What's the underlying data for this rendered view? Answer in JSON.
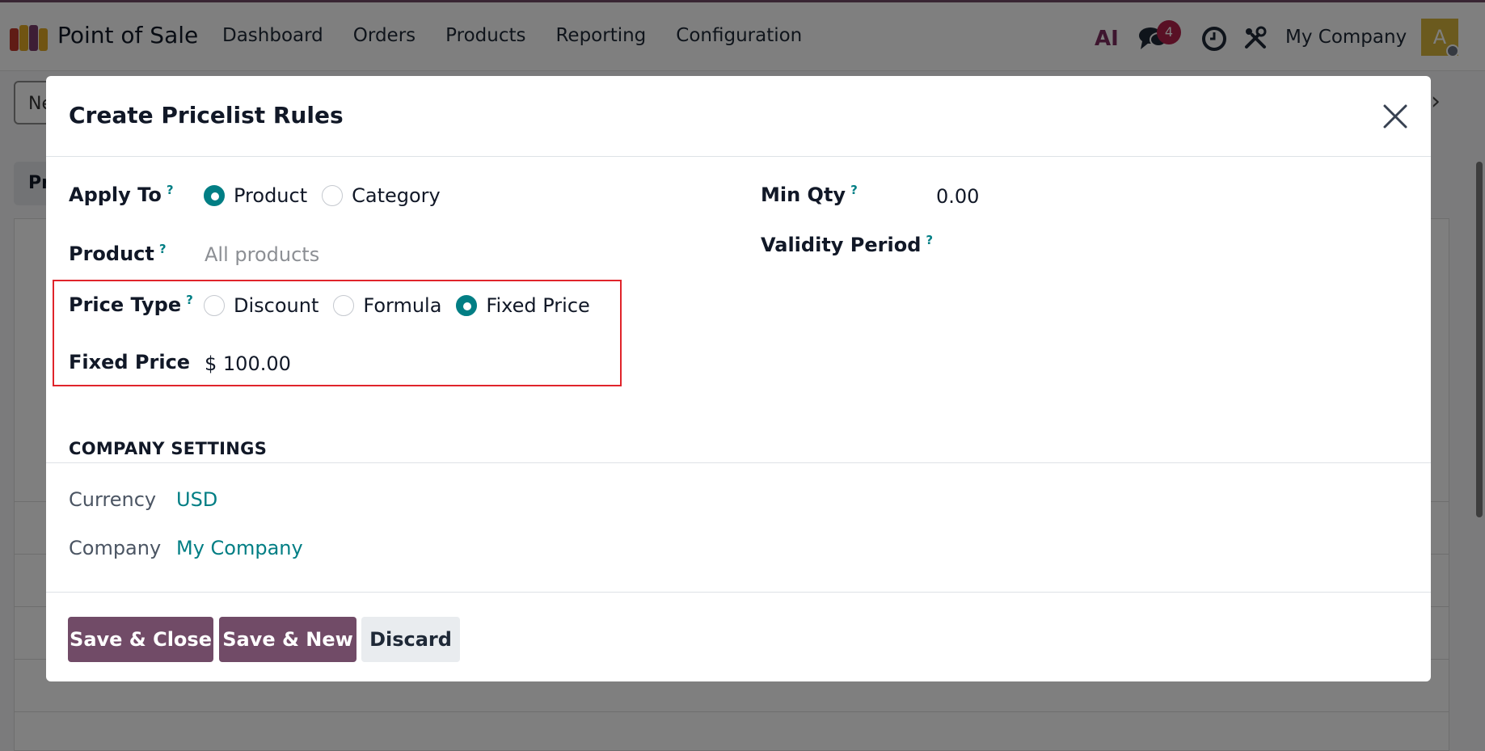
{
  "navbar": {
    "app_title": "Point of Sale",
    "menu": [
      "Dashboard",
      "Orders",
      "Products",
      "Reporting",
      "Configuration"
    ],
    "ai_label": "AI",
    "messages_badge": "4",
    "company": "My Company",
    "avatar_letter": "A"
  },
  "background": {
    "search_text": "Ne",
    "tab_text": "Pr"
  },
  "modal": {
    "title": "Create Pricelist Rules",
    "help_mark": "?",
    "apply_to": {
      "label": "Apply To",
      "options": [
        "Product",
        "Category"
      ],
      "selected": "Product"
    },
    "product": {
      "label": "Product",
      "placeholder": "All products"
    },
    "price_type": {
      "label": "Price Type",
      "options": [
        "Discount",
        "Formula",
        "Fixed Price"
      ],
      "selected": "Fixed Price"
    },
    "fixed_price": {
      "label": "Fixed Price",
      "value": "$ 100.00"
    },
    "min_qty": {
      "label": "Min Qty",
      "value": "0.00"
    },
    "validity_period": {
      "label": "Validity Period"
    },
    "company_settings": {
      "title": "COMPANY SETTINGS",
      "currency_label": "Currency",
      "currency_value": "USD",
      "company_label": "Company",
      "company_value": "My Company"
    },
    "footer": {
      "save_close": "Save & Close",
      "save_new": "Save & New",
      "discard": "Discard"
    }
  },
  "colors": {
    "accent": "#017e84",
    "primary_button": "#714b67",
    "highlight_border": "#e0242b"
  }
}
